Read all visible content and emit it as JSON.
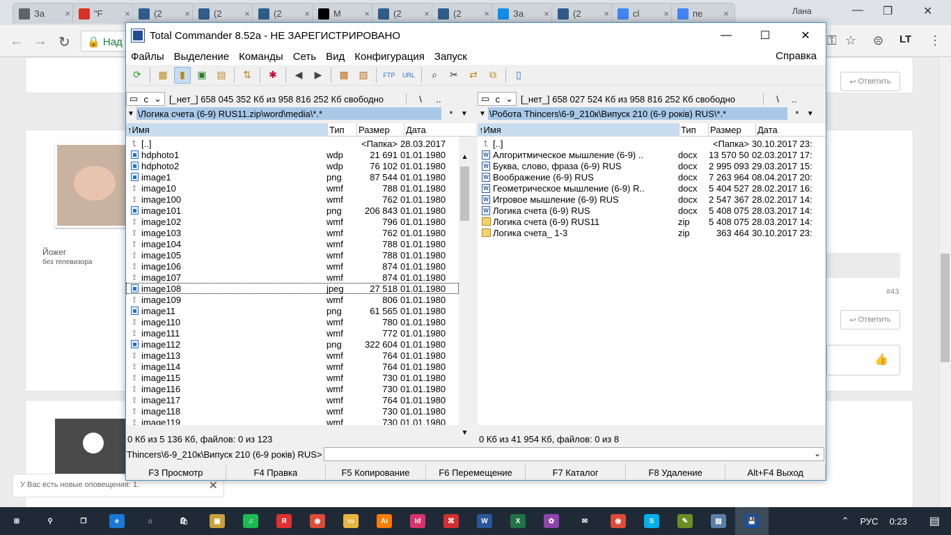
{
  "browser": {
    "tabs": [
      {
        "title": "За",
        "icon": "download-icon",
        "color": "#5f6368"
      },
      {
        "title": "\"F",
        "icon": "gmail-icon",
        "color": "#d93025"
      },
      {
        "title": "(2",
        "icon": "dtp-icon",
        "color": "#2f5d8c"
      },
      {
        "title": "(2",
        "icon": "dtp-icon",
        "color": "#2f5d8c"
      },
      {
        "title": "(2",
        "icon": "dtp-icon",
        "color": "#2f5d8c"
      },
      {
        "title": "M",
        "icon": "wikipedia-icon",
        "color": "#000000"
      },
      {
        "title": "(2",
        "icon": "dtp-icon",
        "color": "#2f5d8c"
      },
      {
        "title": "(2",
        "icon": "dtp-icon",
        "color": "#2f5d8c"
      },
      {
        "title": "За",
        "icon": "teamviewer-icon",
        "color": "#0e8ee9"
      },
      {
        "title": "(2",
        "icon": "dtp-icon",
        "color": "#2f5d8c"
      },
      {
        "title": "сl",
        "icon": "google-icon",
        "color": "#4285f4"
      },
      {
        "title": "пе",
        "icon": "google-icon",
        "color": "#4285f4"
      }
    ],
    "user": "Лана",
    "address_start": "Над"
  },
  "web": {
    "reply_label": "Ответить",
    "author": "Йожег",
    "author_status": "без телевизора",
    "post_number": "#43",
    "notification": "У Вас есть новые оповещения: 1."
  },
  "tc": {
    "title": "Total Commander 8.52a - НЕ ЗАРЕГИСТРИРОВАНО",
    "menu": [
      "Файлы",
      "Выделение",
      "Команды",
      "Сеть",
      "Вид",
      "Конфигурация",
      "Запуск"
    ],
    "help": "Справка",
    "columns": {
      "name": "Имя",
      "ext": "Тип",
      "size": "Размер",
      "date": "Дата"
    },
    "left": {
      "drive": "c",
      "drive_info": "[_нет_]  658 045 352 Кб из 958 816 252 Кб свободно",
      "root": "\\",
      "up": "..",
      "path": "\\Логика счета (6-9) RUS11.zip\\word\\media\\*.*",
      "star": "*",
      "status": "0 Кб из 5 136 Кб, файлов: 0 из 123",
      "rows": [
        {
          "icon": "up",
          "name": "[..]",
          "ext": "",
          "size": "<Папка>",
          "date": "28.03.2017"
        },
        {
          "icon": "img",
          "name": "hdphoto1",
          "ext": "wdp",
          "size": "21 691",
          "date": "01.01.1980"
        },
        {
          "icon": "img",
          "name": "hdphoto2",
          "ext": "wdp",
          "size": "76 102",
          "date": "01.01.1980"
        },
        {
          "icon": "img",
          "name": "image1",
          "ext": "png",
          "size": "87 544",
          "date": "01.01.1980"
        },
        {
          "icon": "wmf",
          "name": "image10",
          "ext": "wmf",
          "size": "788",
          "date": "01.01.1980"
        },
        {
          "icon": "wmf",
          "name": "image100",
          "ext": "wmf",
          "size": "762",
          "date": "01.01.1980"
        },
        {
          "icon": "img",
          "name": "image101",
          "ext": "png",
          "size": "206 843",
          "date": "01.01.1980"
        },
        {
          "icon": "wmf",
          "name": "image102",
          "ext": "wmf",
          "size": "796",
          "date": "01.01.1980"
        },
        {
          "icon": "wmf",
          "name": "image103",
          "ext": "wmf",
          "size": "762",
          "date": "01.01.1980"
        },
        {
          "icon": "wmf",
          "name": "image104",
          "ext": "wmf",
          "size": "788",
          "date": "01.01.1980"
        },
        {
          "icon": "wmf",
          "name": "image105",
          "ext": "wmf",
          "size": "788",
          "date": "01.01.1980"
        },
        {
          "icon": "wmf",
          "name": "image106",
          "ext": "wmf",
          "size": "874",
          "date": "01.01.1980"
        },
        {
          "icon": "wmf",
          "name": "image107",
          "ext": "wmf",
          "size": "874",
          "date": "01.01.1980"
        },
        {
          "icon": "img",
          "name": "image108",
          "ext": "jpeg",
          "size": "27 518",
          "date": "01.01.1980",
          "focus": true
        },
        {
          "icon": "wmf",
          "name": "image109",
          "ext": "wmf",
          "size": "806",
          "date": "01.01.1980"
        },
        {
          "icon": "img",
          "name": "image11",
          "ext": "png",
          "size": "61 565",
          "date": "01.01.1980"
        },
        {
          "icon": "wmf",
          "name": "image110",
          "ext": "wmf",
          "size": "780",
          "date": "01.01.1980"
        },
        {
          "icon": "wmf",
          "name": "image111",
          "ext": "wmf",
          "size": "772",
          "date": "01.01.1980"
        },
        {
          "icon": "img",
          "name": "image112",
          "ext": "png",
          "size": "322 604",
          "date": "01.01.1980"
        },
        {
          "icon": "wmf",
          "name": "image113",
          "ext": "wmf",
          "size": "764",
          "date": "01.01.1980"
        },
        {
          "icon": "wmf",
          "name": "image114",
          "ext": "wmf",
          "size": "764",
          "date": "01.01.1980"
        },
        {
          "icon": "wmf",
          "name": "image115",
          "ext": "wmf",
          "size": "730",
          "date": "01.01.1980"
        },
        {
          "icon": "wmf",
          "name": "image116",
          "ext": "wmf",
          "size": "730",
          "date": "01.01.1980"
        },
        {
          "icon": "wmf",
          "name": "image117",
          "ext": "wmf",
          "size": "764",
          "date": "01.01.1980"
        },
        {
          "icon": "wmf",
          "name": "image118",
          "ext": "wmf",
          "size": "730",
          "date": "01.01.1980"
        },
        {
          "icon": "wmf",
          "name": "image119",
          "ext": "wmf",
          "size": "730",
          "date": "01.01.1980"
        }
      ]
    },
    "right": {
      "drive": "c",
      "drive_info": "[_нет_]  658 027 524 Кб из 958 816 252 Кб свободно",
      "root": "\\",
      "up": "..",
      "path": "\\Робота Thincers\\6-9_210к\\Випуск 210 (6-9 років) RUS\\*.*",
      "star": "*",
      "status": "0 Кб из 41 954 Кб, файлов: 0 из 8",
      "rows": [
        {
          "icon": "up",
          "name": "[..]",
          "ext": "",
          "size": "<Папка>",
          "date": "30.10.2017 23:"
        },
        {
          "icon": "doc",
          "name": "Алгоритмическое мышление (6-9) ..",
          "ext": "docx",
          "size": "13 570 507",
          "date": "02.03.2017 17:"
        },
        {
          "icon": "doc",
          "name": "Буква, слово, фраза (6-9) RUS",
          "ext": "docx",
          "size": "2 995 093",
          "date": "29.03.2017 15:"
        },
        {
          "icon": "doc",
          "name": "Воображение (6-9) RUS",
          "ext": "docx",
          "size": "7 263 964",
          "date": "08.04.2017 20:"
        },
        {
          "icon": "doc",
          "name": "Геометрическое мышление (6-9) R..",
          "ext": "docx",
          "size": "5 404 527",
          "date": "28.02.2017 16:"
        },
        {
          "icon": "doc",
          "name": "Игровое мышление (6-9) RUS",
          "ext": "docx",
          "size": "2 547 367",
          "date": "28.02.2017 14:"
        },
        {
          "icon": "doc",
          "name": "Логика счета (6-9) RUS",
          "ext": "docx",
          "size": "5 408 075",
          "date": "28.03.2017 14:"
        },
        {
          "icon": "zip",
          "name": "Логика счета (6-9) RUS11",
          "ext": "zip",
          "size": "5 408 075",
          "date": "28.03.2017 14:"
        },
        {
          "icon": "zip",
          "name": "Логика счета_ 1-3",
          "ext": "zip",
          "size": "363 464",
          "date": "30.10.2017 23:"
        }
      ]
    },
    "cmd_prompt": "Thincers\\6-9_210к\\Випуск 210 (6-9 років) RUS>",
    "fkeys": [
      "F3 Просмотр",
      "F4 Правка",
      "F5 Копирование",
      "F6 Перемещение",
      "F7 Каталог",
      "F8 Удаление",
      "Alt+F4 Выход"
    ]
  },
  "taskbar": {
    "lang": "РУС",
    "time": "0:23",
    "apps": [
      {
        "name": "start-button",
        "glyph": "⊞",
        "color": "#1f2a36"
      },
      {
        "name": "search-button",
        "glyph": "⚲",
        "color": "#1f2a36"
      },
      {
        "name": "task-view-button",
        "glyph": "❐",
        "color": "#1f2a36"
      },
      {
        "name": "edge-icon",
        "glyph": "e",
        "color": "#1b78d6"
      },
      {
        "name": "home-icon",
        "glyph": "⌂",
        "color": "#1f2a36"
      },
      {
        "name": "store-icon",
        "glyph": "🛍",
        "color": "#1f2a36"
      },
      {
        "name": "app-icon",
        "glyph": "▣",
        "color": "#c8a23a"
      },
      {
        "name": "spotify-icon",
        "glyph": "♫",
        "color": "#1db954"
      },
      {
        "name": "yandex-icon",
        "glyph": "Я",
        "color": "#e03030"
      },
      {
        "name": "chrome-icon",
        "glyph": "◉",
        "color": "#dd4b39"
      },
      {
        "name": "explorer-icon",
        "glyph": "▭",
        "color": "#e8b640"
      },
      {
        "name": "illustrator-icon",
        "glyph": "Ai",
        "color": "#ff7c00"
      },
      {
        "name": "indesign-icon",
        "glyph": "Id",
        "color": "#d6336c"
      },
      {
        "name": "acrobat-icon",
        "glyph": "⌘",
        "color": "#d32f2f"
      },
      {
        "name": "word-icon",
        "glyph": "W",
        "color": "#2b579a"
      },
      {
        "name": "excel-icon",
        "glyph": "X",
        "color": "#217346"
      },
      {
        "name": "colorful-app-icon",
        "glyph": "✿",
        "color": "#8e44ad"
      },
      {
        "name": "mail-icon",
        "glyph": "✉",
        "color": "#1f2a36"
      },
      {
        "name": "chrome-2-icon",
        "glyph": "◉",
        "color": "#dd4b39"
      },
      {
        "name": "skype-icon",
        "glyph": "S",
        "color": "#00aff0"
      },
      {
        "name": "paint-icon",
        "glyph": "✎",
        "color": "#6b8e23"
      },
      {
        "name": "monitor-icon",
        "glyph": "▤",
        "color": "#5a7fa8"
      },
      {
        "name": "total-commander-icon",
        "glyph": "💾",
        "color": "#1f4e99",
        "active": true
      }
    ]
  }
}
